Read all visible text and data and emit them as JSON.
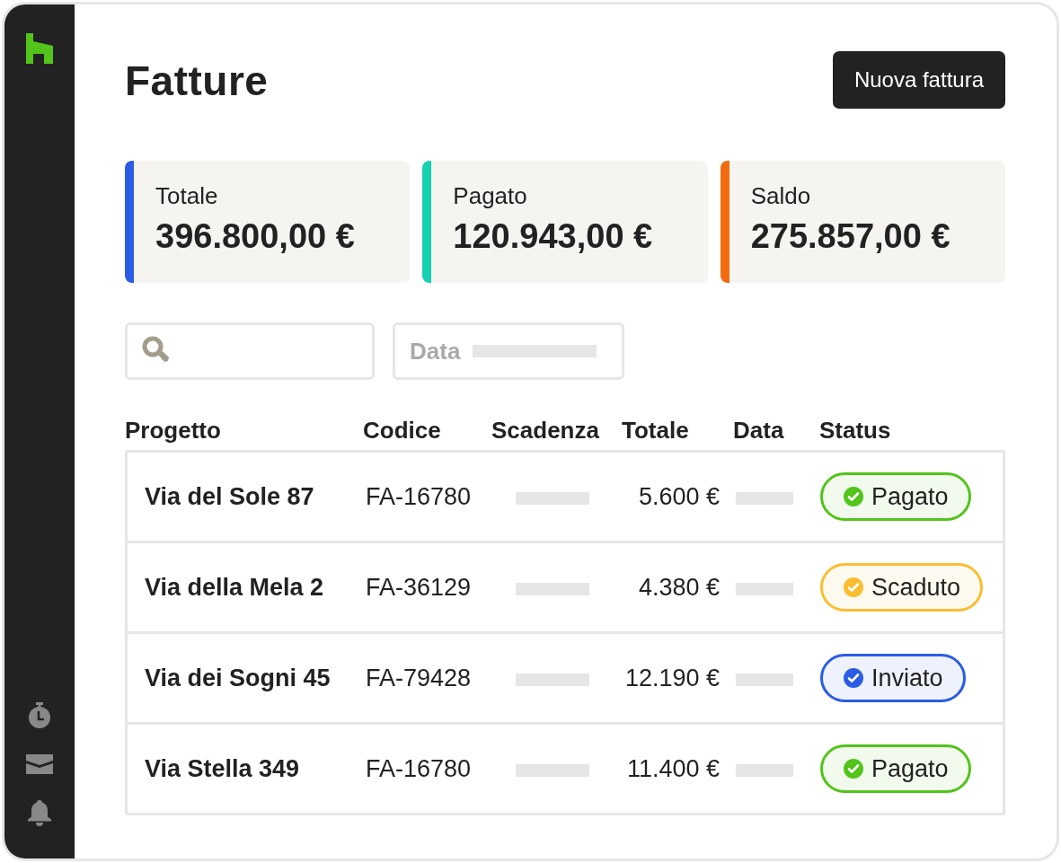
{
  "page": {
    "title": "Fatture",
    "new_button": "Nuova fattura"
  },
  "summary": [
    {
      "label": "Totale",
      "value": "396.800,00 €",
      "color": "#2b5ce6"
    },
    {
      "label": "Pagato",
      "value": "120.943,00 €",
      "color": "#14d1b0"
    },
    {
      "label": "Saldo",
      "value": "275.857,00 €",
      "color": "#f26b0f"
    }
  ],
  "filters": {
    "date_label": "Data"
  },
  "table": {
    "columns": [
      "Progetto",
      "Codice",
      "Scadenza",
      "Totale",
      "Data",
      "Status"
    ],
    "rows": [
      {
        "project": "Via del Sole 87",
        "code": "FA-16780",
        "total": "5.600 €",
        "status": "Pagato",
        "color": "#52c41a"
      },
      {
        "project": "Via della Mela 2",
        "code": "FA-36129",
        "total": "4.380 €",
        "status": "Scaduto",
        "color": "#fbbd30"
      },
      {
        "project": "Via dei Sogni 45",
        "code": "FA-79428",
        "total": "12.190 €",
        "status": "Inviato",
        "color": "#2b5ce6"
      },
      {
        "project": "Via Stella 349",
        "code": "FA-16780",
        "total": "11.400 €",
        "status": "Pagato",
        "color": "#52c41a"
      }
    ]
  }
}
